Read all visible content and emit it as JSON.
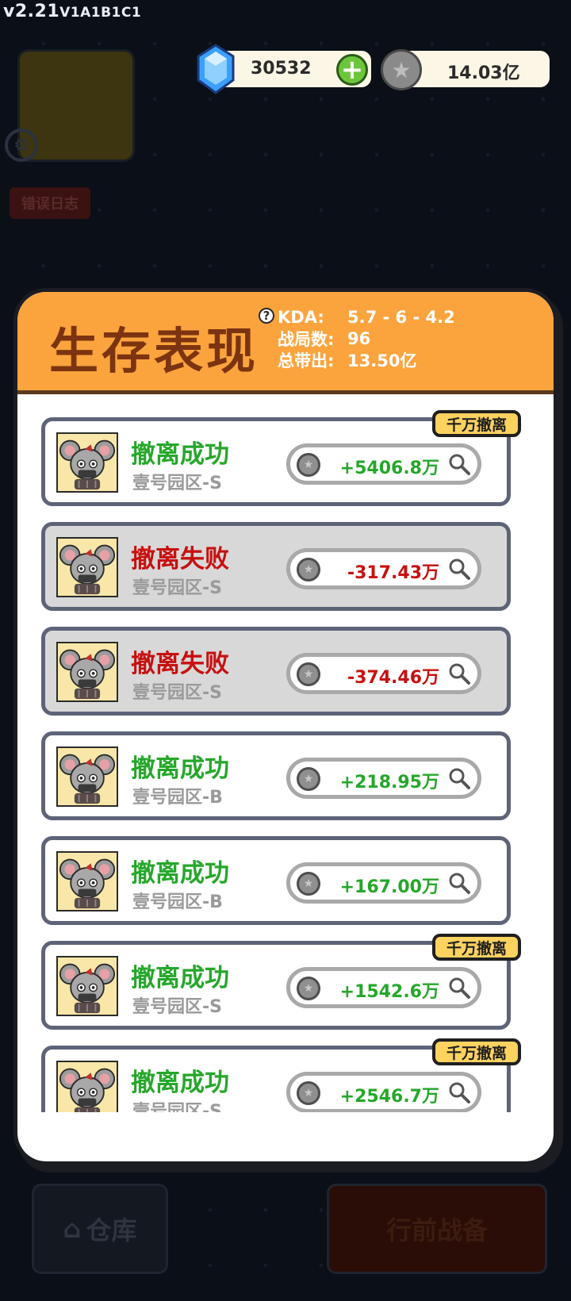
{
  "version": {
    "main": "v2.21",
    "build": "V1A1B1C1"
  },
  "currency": {
    "gems": "30532",
    "coins": "14.03亿"
  },
  "background": {
    "error_log": "错误日志",
    "warehouse": "仓库",
    "prepare": "行前战备"
  },
  "modal": {
    "title": "生存表现",
    "stats": {
      "kda_label": "KDA:",
      "kda_value": "5.7 - 6 - 4.2",
      "matches_label": "战局数:",
      "matches_value": "96",
      "output_label": "总带出:",
      "output_value": "13.50亿"
    },
    "records": [
      {
        "status": "撤离成功",
        "result": "success",
        "zone": "壹号园区-S",
        "amount": "+5406.8万",
        "badge": "千万撤离"
      },
      {
        "status": "撤离失败",
        "result": "fail",
        "zone": "壹号园区-S",
        "amount": "-317.43万",
        "badge": ""
      },
      {
        "status": "撤离失败",
        "result": "fail",
        "zone": "壹号园区-S",
        "amount": "-374.46万",
        "badge": ""
      },
      {
        "status": "撤离成功",
        "result": "success",
        "zone": "壹号园区-B",
        "amount": "+218.95万",
        "badge": ""
      },
      {
        "status": "撤离成功",
        "result": "success",
        "zone": "壹号园区-B",
        "amount": "+167.00万",
        "badge": ""
      },
      {
        "status": "撤离成功",
        "result": "success",
        "zone": "壹号园区-S",
        "amount": "+1542.6万",
        "badge": "千万撤离"
      },
      {
        "status": "撤离成功",
        "result": "success",
        "zone": "壹号园区-S",
        "amount": "+2546.7万",
        "badge": "千万撤离"
      }
    ]
  },
  "colors": {
    "success": "#25a72a",
    "fail": "#c71010",
    "header": "#fba43d",
    "badge": "#fed25f"
  }
}
